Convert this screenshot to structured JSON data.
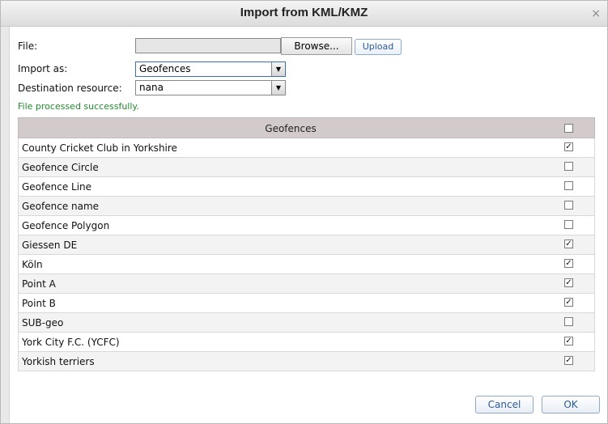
{
  "dialog": {
    "title": "Import from KML/KMZ",
    "close_glyph": "×"
  },
  "form": {
    "file_label": "File:",
    "browse_label": "Browse...",
    "upload_label": "Upload",
    "import_as_label": "Import as:",
    "import_as_value": "Geofences",
    "destination_label": "Destination resource:",
    "destination_value": "nana",
    "dropdown_glyph": "▼"
  },
  "status": {
    "text": "File processed successfully."
  },
  "table": {
    "header": "Geofences",
    "header_checked": false,
    "rows": [
      {
        "name": "County Cricket Club in Yorkshire",
        "checked": true
      },
      {
        "name": "Geofence Circle",
        "checked": false
      },
      {
        "name": "Geofence Line",
        "checked": false
      },
      {
        "name": "Geofence name",
        "checked": false
      },
      {
        "name": "Geofence Polygon",
        "checked": false
      },
      {
        "name": "Giessen DE",
        "checked": true
      },
      {
        "name": "Köln",
        "checked": true
      },
      {
        "name": "Point A",
        "checked": true
      },
      {
        "name": "Point B",
        "checked": true
      },
      {
        "name": "SUB-geo",
        "checked": false
      },
      {
        "name": "York City F.C. (YCFC)",
        "checked": true
      },
      {
        "name": "Yorkish terriers",
        "checked": true
      }
    ]
  },
  "footer": {
    "cancel_label": "Cancel",
    "ok_label": "OK"
  },
  "colors": {
    "status_green": "#1f8b2a",
    "link_blue": "#2b5a9a",
    "header_bg": "#d3cbcb"
  },
  "icons": {
    "close": "close-icon",
    "dropdown": "chevron-down-icon",
    "checkbox": "checkbox-icon"
  }
}
